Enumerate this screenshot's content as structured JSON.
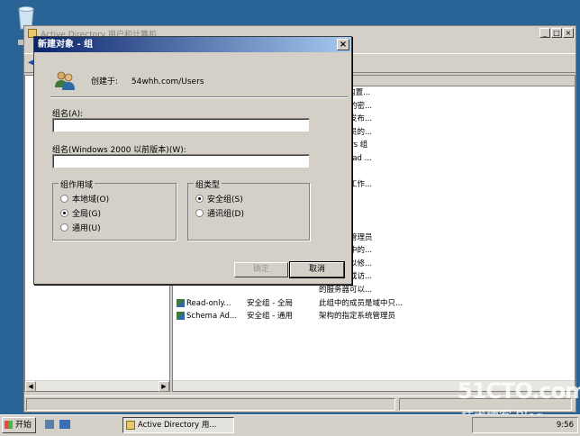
{
  "main_window": {
    "title": "Active Directory 用户和计算机"
  },
  "list_rows": [
    {
      "c3": "机(域)的内置..."
    },
    {
      "c3": "组中成员的密..."
    },
    {
      "c3": "员被允许发布..."
    },
    {
      "c3": "此组中成员的..."
    },
    {
      "c3": "inistrators 组"
    },
    {
      "c3": "他客户端(ad ..."
    },
    {
      "c3": "管理员"
    },
    {
      "c3": "中的所有工作..."
    },
    {
      "c3": "域控制器"
    },
    {
      "c3": "来宾"
    },
    {
      "c3": "户"
    },
    {
      "c3": "指定系统管理员"
    },
    {
      "c3": "员是企业中的..."
    },
    {
      "c3": "的成员可以修..."
    },
    {
      "c3": "问计算机或访..."
    },
    {
      "c3": "的服务器可以..."
    },
    {
      "c1": "Read-only...",
      "c2": "安全组 - 全局",
      "c3": "此组中的成员是域中只..."
    },
    {
      "c1": "Schema Ad...",
      "c2": "安全组 - 通用",
      "c3": "架构的指定系统管理员"
    }
  ],
  "dialog": {
    "title": "新建对象 - 组",
    "created_in_label": "创建于:",
    "created_in_path": "54whh.com/Users",
    "group_name_label": "组名(A):",
    "group_name_value": "",
    "pre2000_label": "组名(Windows 2000 以前版本)(W):",
    "pre2000_value": "",
    "scope": {
      "title": "组作用域",
      "options": [
        "本地域(O)",
        "全局(G)",
        "通用(U)"
      ],
      "selected": "全局(G)"
    },
    "type": {
      "title": "组类型",
      "options": [
        "安全组(S)",
        "通讯组(D)"
      ],
      "selected": "安全组(S)"
    },
    "ok_label": "确定",
    "cancel_label": "取消"
  },
  "taskbar": {
    "start_label": "开始",
    "task_label": "Active Directory 用...",
    "clock": "9:56"
  },
  "watermark": {
    "line1": "51CTO.com",
    "line2": "技术博客 Blog"
  }
}
